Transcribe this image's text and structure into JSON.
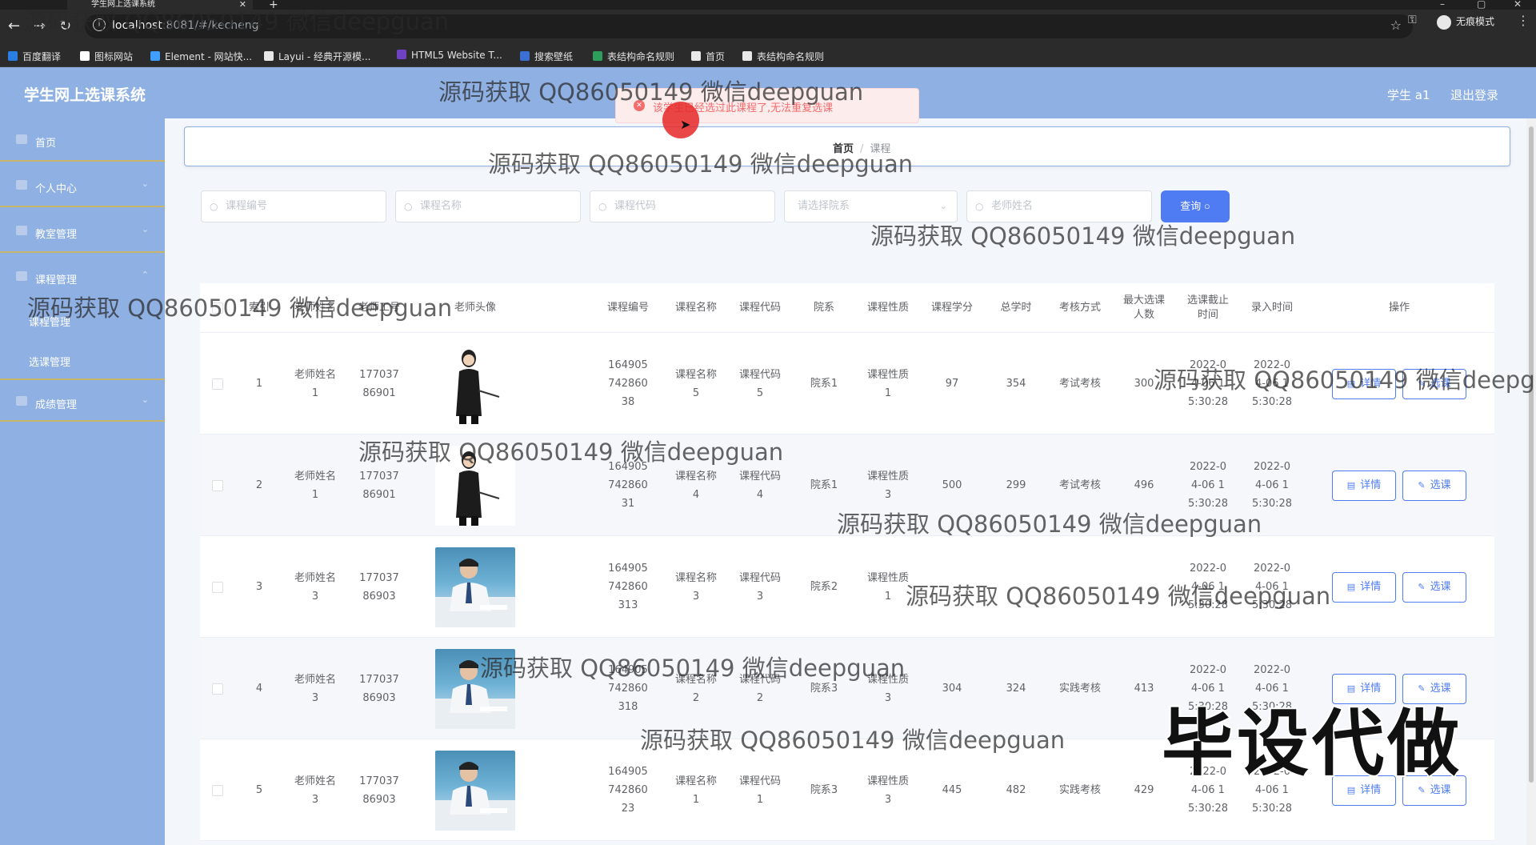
{
  "browser": {
    "tab_title": "学生网上选课系统",
    "tab_close": "✕",
    "new_tab": "+",
    "url_host": "localhost",
    "url_rest": ":8081/#/kecheng",
    "incognito": "无痕模式",
    "bookmarks": [
      {
        "label": "百度翻译",
        "color": "#2a7de1"
      },
      {
        "label": "图标网站",
        "color": "#ffffff"
      },
      {
        "label": "Element - 网站快...",
        "color": "#409eff"
      },
      {
        "label": "Layui - 经典开源模...",
        "color": "#e8e8e8"
      },
      {
        "label": "HTML5 Website T...",
        "color": "#6f42c1"
      },
      {
        "label": "搜索壁纸",
        "color": "#3b6fd4"
      },
      {
        "label": "表结构命名规则",
        "color": "#2e9e5b"
      },
      {
        "label": "首页",
        "color": "#e8e8e8"
      },
      {
        "label": "表结构命名规则",
        "color": "#e8e8e8"
      }
    ]
  },
  "app": {
    "title": "学生网上选课系统",
    "user": "学生 a1",
    "logout": "退出登录"
  },
  "sidebar": {
    "items": [
      {
        "label": "首页"
      },
      {
        "label": "个人中心"
      },
      {
        "label": "教室管理"
      },
      {
        "label": "课程管理"
      },
      {
        "label": "成绩管理"
      }
    ],
    "sub_items": [
      {
        "label": "课程管理"
      },
      {
        "label": "选课管理"
      }
    ]
  },
  "breadcrumb": {
    "home": "首页",
    "separator": "/",
    "current": "课程"
  },
  "search": {
    "course_no": "课程编号",
    "course_name": "课程名称",
    "course_code": "课程代码",
    "dept": "请选择院系",
    "teacher": "老师姓名",
    "query": "查询"
  },
  "toast": {
    "message": "该学生已经选过此课程了,无法重复选课",
    "type": "error"
  },
  "table": {
    "headers": [
      "索引",
      "老师姓名",
      "老师工号",
      "老师头像",
      "课程编号",
      "课程名称",
      "课程代码",
      "院系",
      "课程性质",
      "课程学分",
      "总学时",
      "考核方式",
      "最大选课人数",
      "选课截止时间",
      "录入时间",
      "操作"
    ],
    "detail_label": "详情",
    "select_label": "选课",
    "rows": [
      {
        "index": "1",
        "teacher": "老师姓名1",
        "teacher_no": "17703786901",
        "avatar": "woman",
        "course_no": "16490574286038",
        "name": "课程名称5",
        "code": "课程代码5",
        "dept": "院系1",
        "nature": "课程性质1",
        "credit": "97",
        "hours": "354",
        "exam": "考试考核",
        "max": "300",
        "deadline": "2022-04-06 15:30:28",
        "created": "2022-04-06 15:30:28"
      },
      {
        "index": "2",
        "teacher": "老师姓名1",
        "teacher_no": "17703786901",
        "avatar": "woman",
        "course_no": "16490574286031",
        "name": "课程名称4",
        "code": "课程代码4",
        "dept": "院系1",
        "nature": "课程性质3",
        "credit": "500",
        "hours": "299",
        "exam": "考试考核",
        "max": "496",
        "deadline": "2022-04-06 15:30:28",
        "created": "2022-04-06 15:30:28"
      },
      {
        "index": "3",
        "teacher": "老师姓名3",
        "teacher_no": "17703786903",
        "avatar": "man",
        "course_no": "164905742860313",
        "name": "课程名称3",
        "code": "课程代码3",
        "dept": "院系2",
        "nature": "课程性质1",
        "credit": "",
        "hours": "",
        "exam": "",
        "max": "",
        "deadline": "2022-04-06 15:30:28",
        "created": "2022-04-06 15:30:28"
      },
      {
        "index": "4",
        "teacher": "老师姓名3",
        "teacher_no": "17703786903",
        "avatar": "man",
        "course_no": "164905742860318",
        "name": "课程名称2",
        "code": "课程代码2",
        "dept": "院系3",
        "nature": "课程性质3",
        "credit": "304",
        "hours": "324",
        "exam": "实践考核",
        "max": "413",
        "deadline": "2022-04-06 15:30:28",
        "created": "2022-04-06 15:30:28"
      },
      {
        "index": "5",
        "teacher": "老师姓名3",
        "teacher_no": "17703786903",
        "avatar": "man",
        "course_no": "16490574286023",
        "name": "课程名称1",
        "code": "课程代码1",
        "dept": "院系3",
        "nature": "课程性质3",
        "credit": "445",
        "hours": "482",
        "exam": "实践考核",
        "max": "429",
        "deadline": "2022-04-06 15:30:28",
        "created": "2022-04-06 15:30:28"
      }
    ]
  },
  "watermark": {
    "text": "源码获取 QQ86050149 微信deepguan",
    "big": "毕设代做"
  },
  "colors": {
    "accent": "#4f7cf3",
    "sidebar": "#8fb0e3",
    "error": "#f56c6c"
  }
}
